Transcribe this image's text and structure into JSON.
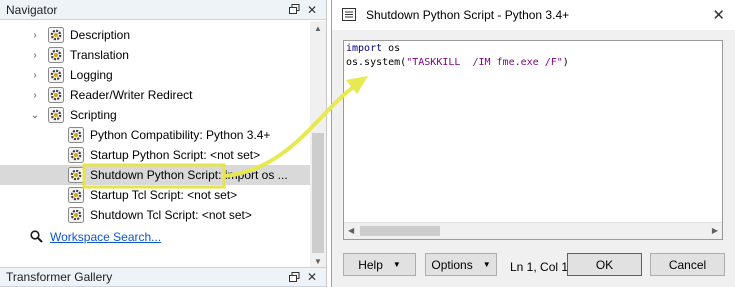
{
  "navigator": {
    "title": "Navigator",
    "items": [
      {
        "label": "Description",
        "expander": "›"
      },
      {
        "label": "Translation",
        "expander": "›"
      },
      {
        "label": "Logging",
        "expander": "›"
      },
      {
        "label": "Reader/Writer Redirect",
        "expander": "›"
      },
      {
        "label": "Scripting",
        "expander": "⌄"
      },
      {
        "label": "Python Compatibility: Python 3.4+"
      },
      {
        "label": "Startup Python Script: <not set>"
      },
      {
        "label": "Shutdown Python Script:",
        "value": "import os ...",
        "selected": true
      },
      {
        "label": "Startup Tcl Script: <not set>"
      },
      {
        "label": "Shutdown Tcl Script: <not set>"
      }
    ],
    "search_link": "Workspace Search..."
  },
  "transformer_gallery": {
    "title": "Transformer Gallery"
  },
  "dialog": {
    "title": "Shutdown Python Script - Python 3.4+",
    "code": {
      "line1_kw": "import",
      "line1_rest": " os",
      "line2_call": "os.system(",
      "line2_str": "\"TASKKILL  /IM fme.exe /F\"",
      "line2_end": ")"
    },
    "help_label": "Help",
    "options_label": "Options",
    "cursor_position": "Ln 1, Col 1",
    "ok_label": "OK",
    "cancel_label": "Cancel"
  },
  "colors": {
    "highlight": "#f5f07a",
    "arrow": "#e8e850",
    "link": "#0b57d0"
  }
}
